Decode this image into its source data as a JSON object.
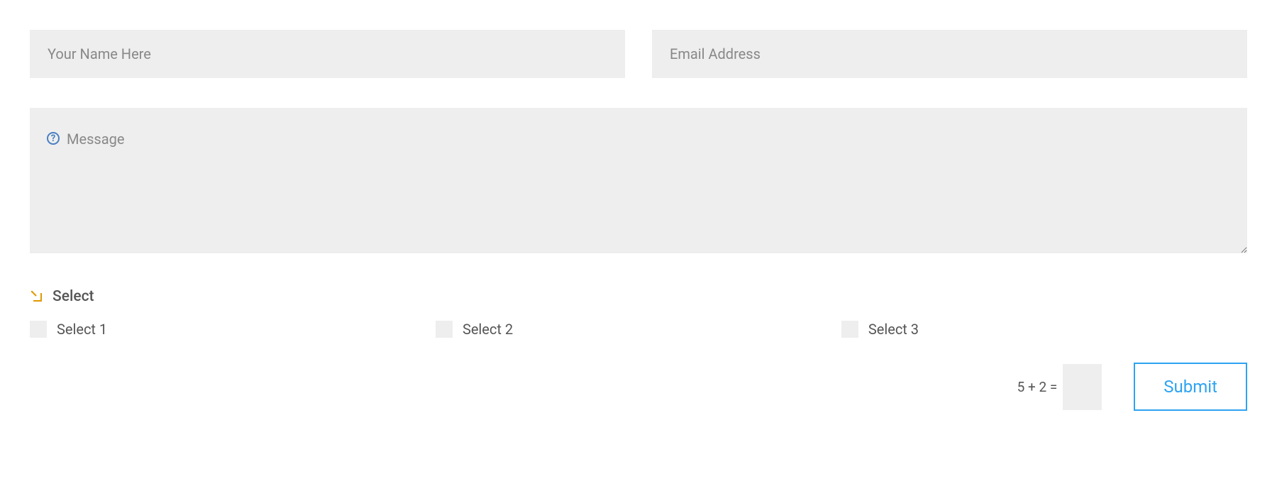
{
  "form": {
    "name_placeholder": "Your Name Here",
    "email_placeholder": "Email Address",
    "message_placeholder": "Message",
    "select_label": "Select",
    "options": [
      {
        "label": "Select 1"
      },
      {
        "label": "Select 2"
      },
      {
        "label": "Select 3"
      }
    ],
    "captcha_question": "5 + 2 =",
    "submit_label": "Submit"
  },
  "colors": {
    "accent": "#2ea3f2",
    "icon_orange": "#e09900",
    "field_bg": "#eeeeee"
  }
}
